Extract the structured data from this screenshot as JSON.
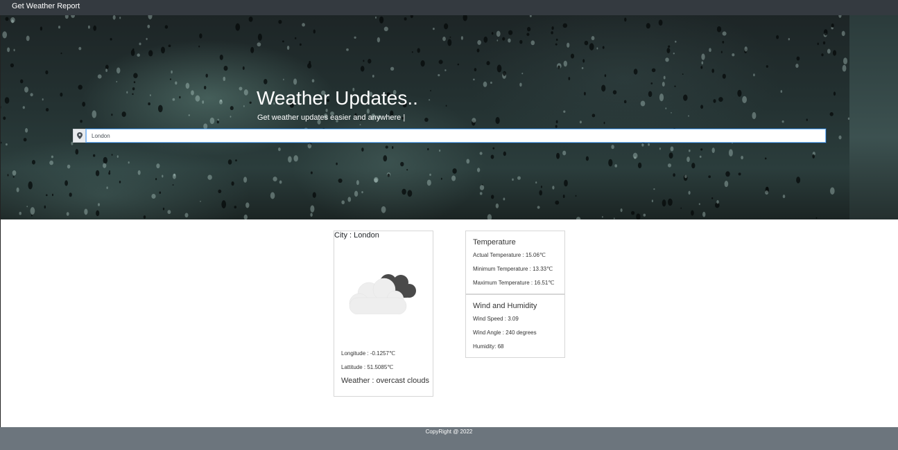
{
  "navbar": {
    "brand": "Get Weather Report"
  },
  "hero": {
    "title": "Weather Updates..",
    "subtitle": "Get weather updates easier and anywhere |",
    "search_value": "London",
    "search_icon": "map-marker-icon"
  },
  "city_card": {
    "city": "City : London",
    "icon": "overcast-clouds-icon",
    "longitude": "Longitude : -0.1257℃",
    "latitude": "Lattitude : 51.5085℃",
    "weather": "Weather : overcast clouds"
  },
  "temperature_card": {
    "title": "Temperature",
    "actual": "Actual Temperature : 15.06℃",
    "minimum": "Minimum Temperature : 13.33℃",
    "maximum": "Maximum Temperature : 16.51℃"
  },
  "wind_card": {
    "title": "Wind and Humidity",
    "speed": "Wind Speed : 3.09",
    "angle": "Wind Angle : 240 degrees",
    "humidity": "Humidity: 68"
  },
  "footer": {
    "text": "CopyRight @ 2022"
  },
  "colors": {
    "navbar": "#343a40",
    "footer": "#6c757d",
    "cloud_light": "#eeeeee",
    "cloud_dark": "#4a4a4a"
  }
}
